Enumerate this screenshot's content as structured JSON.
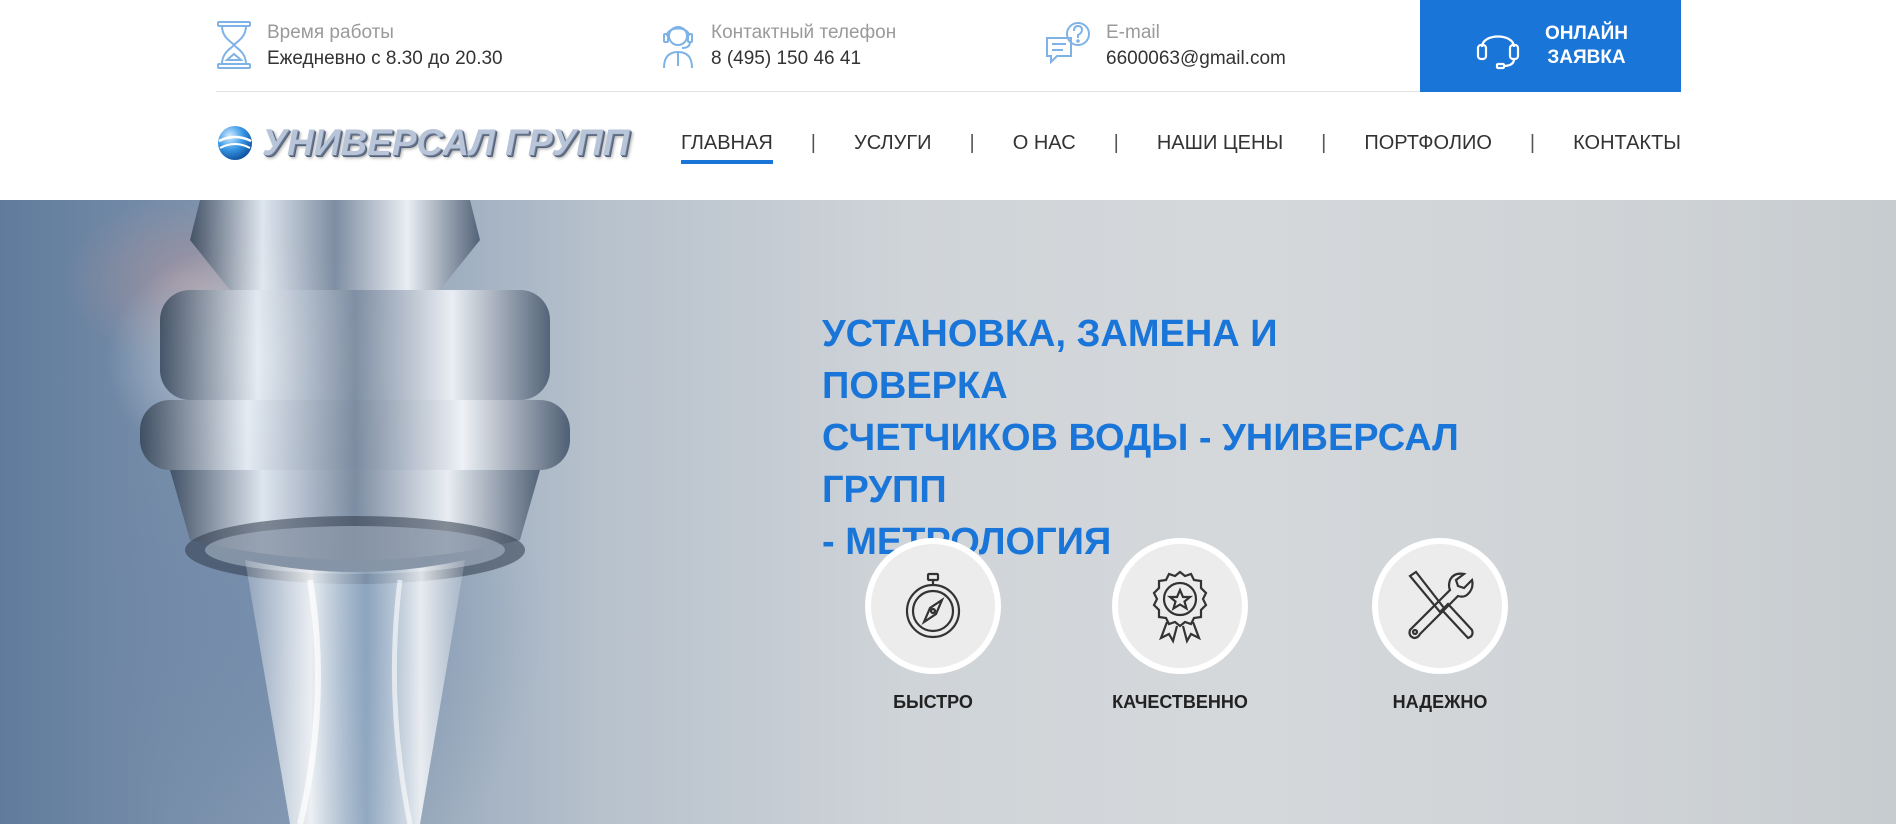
{
  "topbar": {
    "hours": {
      "label": "Время работы",
      "value": "Ежедневно с 8.30 до 20.30",
      "icon": "hourglass-icon"
    },
    "phone": {
      "label": "Контактный телефон",
      "value": "8 (495) 150 46 41",
      "icon": "operator-icon"
    },
    "email": {
      "label": "E-mail",
      "value": "6600063@gmail.com",
      "icon": "chat-question-icon"
    },
    "cta": {
      "line1": "ОНЛАЙН",
      "line2": "ЗАЯВКА",
      "icon": "headset-icon"
    }
  },
  "brand": {
    "name": "УНИВЕРСАЛ ГРУПП"
  },
  "nav": {
    "items": [
      {
        "label": "ГЛАВНАЯ",
        "active": true
      },
      {
        "label": "УСЛУГИ"
      },
      {
        "label": "О НАС"
      },
      {
        "label": "НАШИ ЦЕНЫ"
      },
      {
        "label": "ПОРТФОЛИО"
      },
      {
        "label": "КОНТАКТЫ"
      }
    ],
    "separator": "|"
  },
  "hero": {
    "line1": "УСТАНОВКА, ЗАМЕНА И ПОВЕРКА",
    "line2": "СЧЕТЧИКОВ ВОДЫ - УНИВЕРСАЛ ГРУПП",
    "line3": "- МЕТРОЛОГИЯ"
  },
  "features": [
    {
      "label": "БЫСТРО",
      "icon": "stopwatch-compass-icon"
    },
    {
      "label": "КАЧЕСТВЕННО",
      "icon": "award-badge-icon"
    },
    {
      "label": "НАДЕЖНО",
      "icon": "tools-icon"
    }
  ],
  "colors": {
    "accent": "#1a75d9",
    "text": "#333333",
    "muted": "#9a9a9a"
  }
}
